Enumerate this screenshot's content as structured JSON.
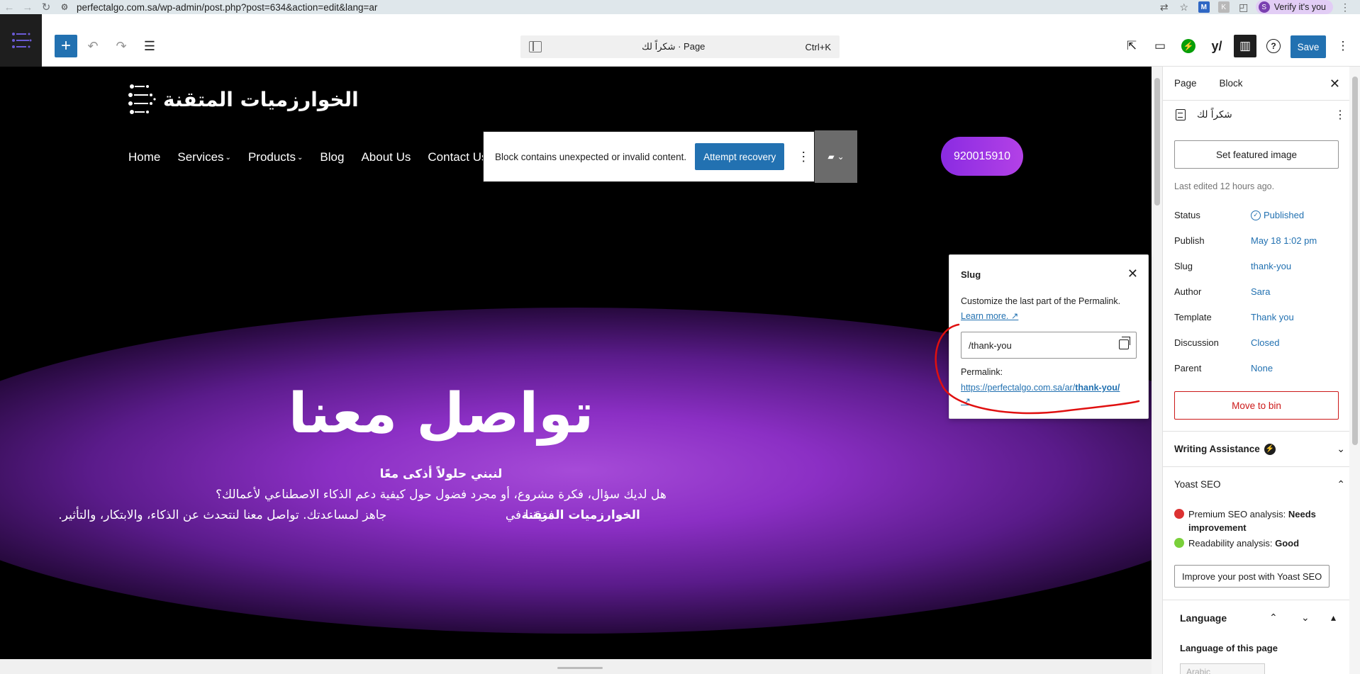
{
  "browser": {
    "url": "perfectalgo.com.sa/wp-admin/post.php?post=634&action=edit&lang=ar",
    "verify_label": "Verify it's you",
    "profile_initial": "S"
  },
  "toolbar": {
    "command_title": "شكراً لك · Page",
    "command_shortcut": "Ctrl+K",
    "save_label": "Save"
  },
  "site": {
    "logo_text": "الخوارزميات المتقنة",
    "nav": [
      "Home",
      "Services",
      "Products",
      "Blog",
      "About Us",
      "Contact Us"
    ],
    "invalid_block_text": "Block contains unexpected or invalid content.",
    "attempt_recovery_label": "Attempt recovery",
    "phone": "920015910",
    "hero_title": "تواصل معنا",
    "hero_sub1": "لنبني حلولاً أذكى معًا",
    "hero_sub2": "هل لديك سؤال، فكرة مشروع، أو مجرد فضول حول كيفية دعم الذكاء الاصطناعي لأعمالك؟",
    "hero_sub3_pre": "فريقنا في ",
    "hero_sub3_bold": "الخوارزميات المتقنة",
    "hero_sub3_post": " جاهز لمساعدتك. تواصل معنا لنتحدث عن الذكاء، والابتكار، والتأثير."
  },
  "slug_popover": {
    "title": "Slug",
    "description": "Customize the last part of the Permalink.",
    "learn_more": "Learn more. ↗",
    "input_value": "/thank-you",
    "permalink_label": "Permalink:",
    "permalink_base": "https://perfectalgo.com.sa/ar/",
    "permalink_slug": "thank-you/",
    "permalink_arrow": "↗"
  },
  "sidebar": {
    "tabs": [
      "Page",
      "Block"
    ],
    "page_title": "شكراً لك",
    "featured_image_label": "Set featured image",
    "last_edited": "Last edited 12 hours ago.",
    "rows": [
      {
        "label": "Status",
        "value": "Published"
      },
      {
        "label": "Publish",
        "value": "May 18 1:02 pm"
      },
      {
        "label": "Slug",
        "value": "thank-you"
      },
      {
        "label": "Author",
        "value": "Sara"
      },
      {
        "label": "Template",
        "value": "Thank you"
      },
      {
        "label": "Discussion",
        "value": "Closed"
      },
      {
        "label": "Parent",
        "value": "None"
      }
    ],
    "move_to_bin": "Move to bin",
    "writing_assistance": "Writing Assistance",
    "yoast_title": "Yoast SEO",
    "premium_label": "Premium SEO analysis: ",
    "premium_value": "Needs improvement",
    "readability_label": "Readability analysis: ",
    "readability_value": "Good",
    "improve_label": "Improve your post with Yoast SEO",
    "language_title": "Language",
    "language_of_page": "Language of this page",
    "language_select": "Arabic"
  },
  "colors": {
    "wp_blue": "#2271b1",
    "danger_red": "#cc1818",
    "hero_purple": "#8a2be2"
  }
}
